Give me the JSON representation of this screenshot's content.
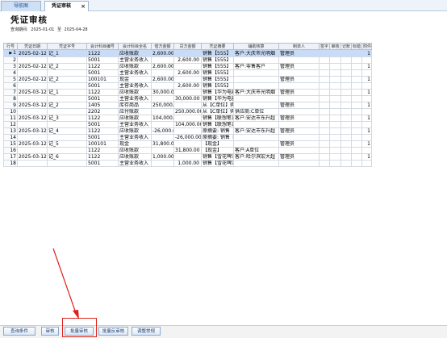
{
  "tabs": {
    "nav_label": "导航图",
    "active_label": "凭证审核",
    "close_glyph": "×"
  },
  "page": {
    "title": "凭证审核",
    "range_label": "查询期间:",
    "range_start": "2025-01-01",
    "range_sep": "至",
    "range_end": "2025-04-28"
  },
  "table": {
    "columns": [
      "行号",
      "凭证日期",
      "凭证字号",
      "会计科目编号",
      "会计科目全名",
      "借方金额",
      "贷方金额",
      "凭证摘要",
      "辅助核算",
      "制单人",
      "签字",
      "审核",
      "记账",
      "标错",
      "附件张数"
    ],
    "rows": [
      [
        "1",
        "2025-02-12",
        "记_1",
        "1122",
        "应收账款",
        "2,600.00",
        "",
        "销售【555】",
        "客户:大庆市光明烟",
        "管理员",
        "",
        "",
        "",
        "",
        "1"
      ],
      [
        "2",
        "",
        "",
        "5001",
        "主营业务收入",
        "",
        "2,600.00",
        "销售【555】",
        "",
        "",
        "",
        "",
        "",
        "",
        ""
      ],
      [
        "3",
        "2025-02-12",
        "记_2",
        "1122",
        "应收账款",
        "2,600.00",
        "",
        "销售【555】",
        "客户:零售客户",
        "管理员",
        "",
        "",
        "",
        "",
        "1"
      ],
      [
        "4",
        "",
        "",
        "5001",
        "主营业务收入",
        "",
        "2,600.00",
        "销售【555】",
        "",
        "",
        "",
        "",
        "",
        "",
        ""
      ],
      [
        "5",
        "2025-02-12",
        "记_2",
        "100101",
        "现金",
        "2,600.00",
        "",
        "销售【555】",
        "",
        "管理员",
        "",
        "",
        "",
        "",
        "1"
      ],
      [
        "6",
        "",
        "",
        "5001",
        "主营业务收入",
        "",
        "2,600.00",
        "销售【555】",
        "",
        "",
        "",
        "",
        "",
        "",
        ""
      ],
      [
        "7",
        "2025-03-12",
        "记_1",
        "1122",
        "应收账款",
        "30,000.00",
        "",
        "销售【华为电器】",
        "客户:大庆市光明烟",
        "管理员",
        "",
        "",
        "",
        "",
        "1"
      ],
      [
        "8",
        "",
        "",
        "5001",
        "主营业务收入",
        "",
        "30,000.00",
        "销售【华为电器】",
        "",
        "",
        "",
        "",
        "",
        "",
        ""
      ],
      [
        "9",
        "2025-03-12",
        "记_2",
        "1405",
        "库存商品",
        "250,000.00",
        "",
        "从【C单位】购入",
        "",
        "管理员",
        "",
        "",
        "",
        "",
        "1"
      ],
      [
        "10",
        "",
        "",
        "2202",
        "应付账款",
        "",
        "250,000.00",
        "从【C单位】购入",
        "供应商:C单位",
        "",
        "",
        "",
        "",
        "",
        ""
      ],
      [
        "11",
        "2025-03-12",
        "记_3",
        "1122",
        "应收账款",
        "104,000.00",
        "",
        "销售【联想笔记本】",
        "客户:安达市东升超",
        "管理员",
        "",
        "",
        "",
        "",
        "1"
      ],
      [
        "12",
        "",
        "",
        "5001",
        "主营业务收入",
        "",
        "104,000.00",
        "销售【联想笔记本】",
        "",
        "",
        "",
        "",
        "",
        "",
        ""
      ],
      [
        "13",
        "2025-03-12",
        "记_4",
        "1122",
        "应收账款",
        "-26,000.00",
        "",
        "原摘要: 销售",
        "客户:安达市东升超",
        "管理员",
        "",
        "",
        "",
        "",
        "1"
      ],
      [
        "14",
        "",
        "",
        "5001",
        "主营业务收入",
        "",
        "-26,000.00",
        "原摘要: 销售【联想】",
        "",
        "",
        "",
        "",
        "",
        "",
        ""
      ],
      [
        "15",
        "2025-03-12",
        "记_5",
        "100101",
        "现金",
        "31,800.00",
        "",
        "【现金】",
        "",
        "管理员",
        "",
        "",
        "",
        "",
        "1"
      ],
      [
        "16",
        "",
        "",
        "1122",
        "应收账款",
        "",
        "31,800.00",
        "【现金】",
        "客户:A单位",
        "",
        "",
        "",
        "",
        "",
        ""
      ],
      [
        "17",
        "2025-03-12",
        "记_6",
        "1122",
        "应收账款",
        "1,000.00",
        "",
        "销售【雪花啤酒】",
        "客户:哈尔滨宏大超",
        "管理员",
        "",
        "",
        "",
        "",
        "1"
      ],
      [
        "18",
        "",
        "",
        "5001",
        "主营业务收入",
        "",
        "1,000.00",
        "销售【雪花啤酒】",
        "",
        "",
        "",
        "",
        "",
        "",
        ""
      ]
    ],
    "selected_row": 0,
    "row_marker_glyph": "▶"
  },
  "buttons": {
    "query_conditions": "查询条件",
    "audit": "审核",
    "batch_audit": "批量审核",
    "batch_unaudit": "批量反审核",
    "adjust_display": "调整常规"
  },
  "colors": {
    "highlight": "#e0211b",
    "selected_row": "#c9dcf7"
  }
}
